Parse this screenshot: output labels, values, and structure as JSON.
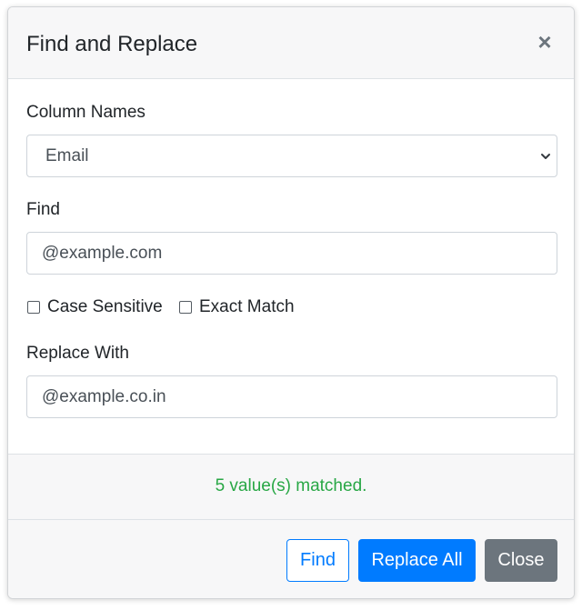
{
  "dialog": {
    "title": "Find and Replace",
    "close_glyph": "×"
  },
  "column": {
    "label": "Column Names",
    "selected": "Email"
  },
  "find": {
    "label": "Find",
    "value": "@example.com"
  },
  "options": {
    "case_sensitive_label": "Case Sensitive",
    "case_sensitive_checked": false,
    "exact_match_label": "Exact Match",
    "exact_match_checked": false
  },
  "replace": {
    "label": "Replace With",
    "value": "@example.co.in"
  },
  "status": {
    "text": "5 value(s) matched.",
    "color": "#28a745"
  },
  "footer": {
    "find_label": "Find",
    "replace_all_label": "Replace All",
    "close_label": "Close"
  },
  "colors": {
    "primary": "#007bff",
    "secondary": "#6c757d",
    "header_bg": "#f7f7f8"
  },
  "icons": {
    "close": "close-icon",
    "select_arrow": "chevron-down-icon"
  }
}
